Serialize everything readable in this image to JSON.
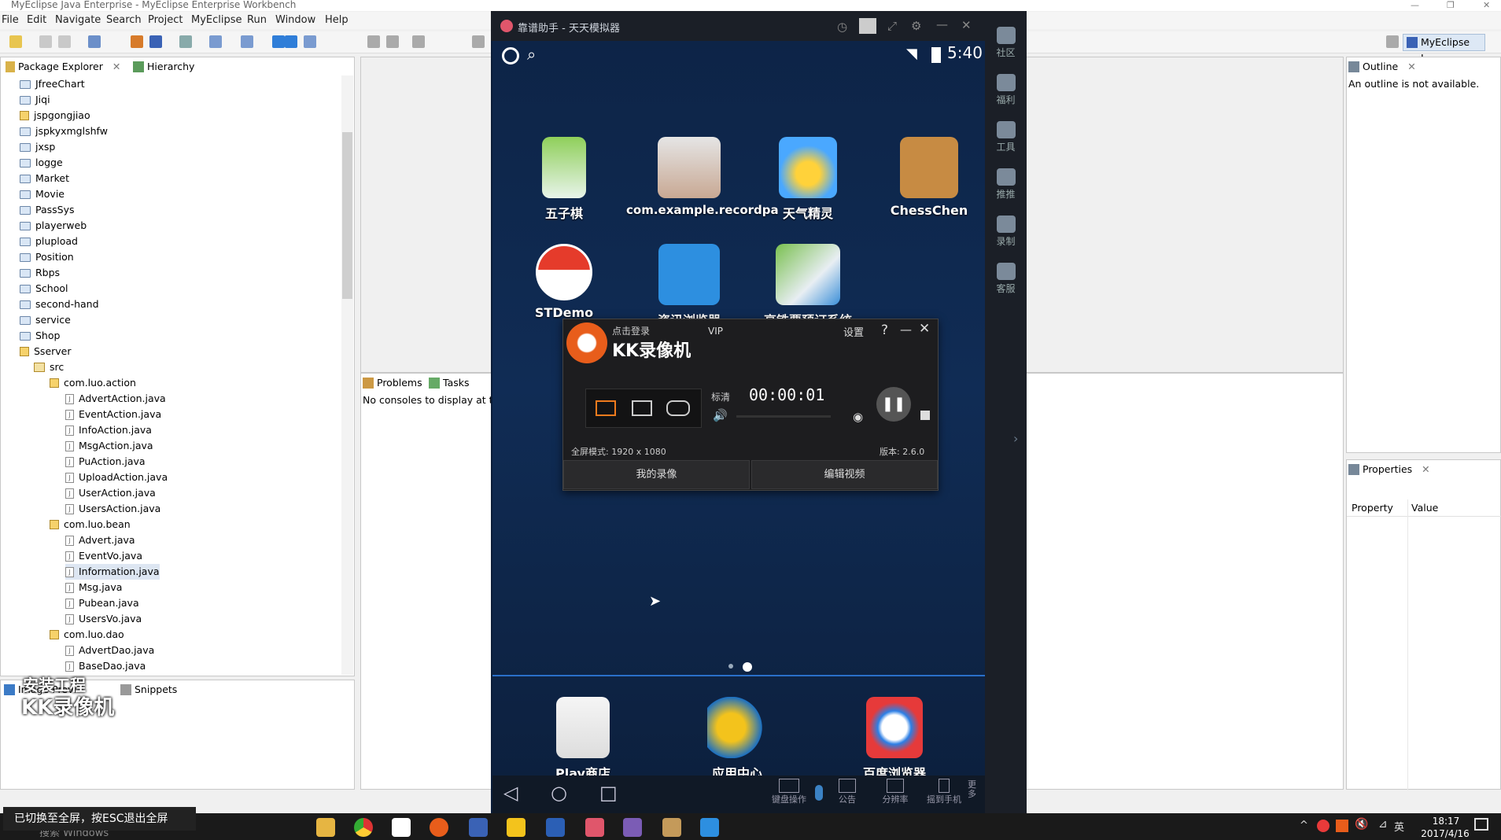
{
  "window": {
    "title": "MyEclipse Java Enterprise - MyEclipse Enterprise Workbench"
  },
  "menu": [
    "File",
    "Edit",
    "Navigate",
    "Search",
    "Project",
    "MyEclipse",
    "Run",
    "Window",
    "Help"
  ],
  "perspective": {
    "label": "MyEclipse J..."
  },
  "package_explorer": {
    "tab": "Package Explorer",
    "tab2": "Hierarchy",
    "projects": [
      "JfreeChart",
      "Jiqi",
      "jspgongjiao",
      "jspkyxmglshfw",
      "jxsp",
      "logge",
      "Market",
      "Movie",
      "PassSys",
      "playerweb",
      "plupload",
      "Position",
      "Rbps",
      "School",
      "second-hand",
      "service",
      "Shop",
      "Sserver"
    ],
    "src": "src",
    "pkg_action": "com.luo.action",
    "action_files": [
      "AdvertAction.java",
      "EventAction.java",
      "InfoAction.java",
      "MsgAction.java",
      "PuAction.java",
      "UploadAction.java",
      "UserAction.java",
      "UsersAction.java"
    ],
    "pkg_bean": "com.luo.bean",
    "bean_files": [
      "Advert.java",
      "EventVo.java",
      "Information.java",
      "Msg.java",
      "Pubean.java",
      "UsersVo.java"
    ],
    "pkg_dao": "com.luo.dao",
    "dao_files": [
      "AdvertDao.java",
      "BaseDao.java"
    ]
  },
  "image_viewer": {
    "tab": "Image Previ",
    "tab2": "Snippets",
    "watermark_line1": "安装工程",
    "watermark_line2": "KK录像机"
  },
  "console": {
    "tab1": "Problems",
    "tab2": "Tasks",
    "message": "No consoles to display at th"
  },
  "outline": {
    "tab": "Outline",
    "message": "An outline is not available."
  },
  "properties": {
    "tab": "Properties",
    "col1": "Property",
    "col2": "Value"
  },
  "emulator": {
    "title": "靠谱助手 - 天天模拟器",
    "time": "5:40",
    "apps_row1": [
      "五子棋",
      "com.example.recordpa",
      "天气精灵",
      "ChessChen"
    ],
    "apps_row2": [
      "STDemo",
      "资讯浏览器",
      "高铁票预订系统"
    ],
    "dock": [
      "Play商店",
      "应用中心",
      "百度浏览器"
    ],
    "side": [
      "社区",
      "福利",
      "工具",
      "推推",
      "录制",
      "客服"
    ],
    "bottom": [
      "键盘操作",
      "公告",
      "分辨率",
      "摇到手机",
      "更多"
    ]
  },
  "kk": {
    "login": "点击登录",
    "vip": "VIP",
    "settings": "设置",
    "help": "?",
    "name": "KK录像机",
    "quality": "标清",
    "timer": "00:00:01",
    "mode": "全屏模式: 1920 x 1080",
    "version": "版本: 2.6.0",
    "btn_my": "我的录像",
    "btn_edit": "编辑视频"
  },
  "toast": "已切换至全屏，按ESC退出全屏",
  "taskbar": {
    "search": "搜索 Windows",
    "time": "18:17",
    "date": "2017/4/16",
    "ime": "英"
  }
}
